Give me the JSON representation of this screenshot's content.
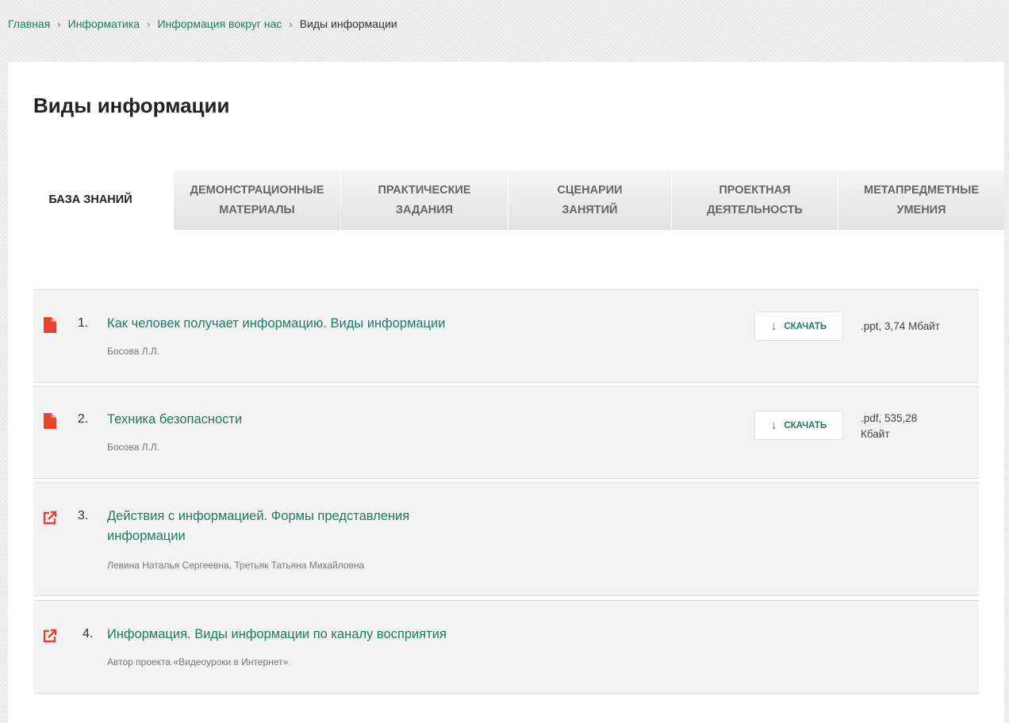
{
  "breadcrumb": {
    "items": [
      "Главная",
      "Информатика",
      "Информация вокруг нас"
    ],
    "current": "Виды информации",
    "separator": "›"
  },
  "page_title": "Виды информации",
  "tabs": [
    {
      "label": "БАЗА ЗНАНИЙ",
      "active": true
    },
    {
      "label": "ДЕМОНСТРАЦИОННЫЕ\nМАТЕРИАЛЫ"
    },
    {
      "label": "ПРАКТИЧЕСКИЕ\nЗАДАНИЯ"
    },
    {
      "label": "СЦЕНАРИИ\nЗАНЯТИЙ"
    },
    {
      "label": "ПРОЕКТНАЯ\nДЕЯТЕЛЬНОСТЬ"
    },
    {
      "label": "МЕТАПРЕДМЕТНЫЕ\nУМЕНИЯ"
    }
  ],
  "download_label": "СКАЧАТЬ",
  "materials": [
    {
      "num": "1.",
      "title": "Как человек получает информацию. Виды информации",
      "author": "Босова Л.Л.",
      "icon": "file-icon",
      "file_info": ".ppt, 3,74 Мбайт"
    },
    {
      "num": "2.",
      "title": "Техника безопасности",
      "author": "Босова Л.Л.",
      "icon": "file-icon",
      "file_info": ".pdf, 535,28 Кбайт"
    },
    {
      "num": "3.",
      "title": "Действия с информацией. Формы представления информации",
      "author": "Левина Наталья Сергеевна, Третьяк Татьяна Михайловна",
      "icon": "external-link-icon"
    },
    {
      "num": "4.",
      "title": "Информация. Виды информации по каналу восприятия",
      "author": "Автор проекта «Видеоуроки в Интернет»",
      "icon": "external-link-icon"
    }
  ],
  "colors": {
    "accent": "#1f7a63",
    "icon": "#e8432f"
  }
}
